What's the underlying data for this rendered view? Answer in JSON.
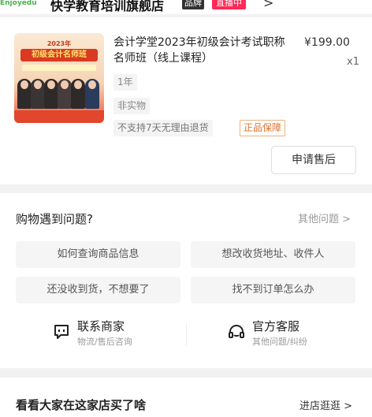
{
  "store": {
    "logo_text": "Enjoyedu",
    "name": "快学教育培训旗舰店",
    "brand_badge": "品牌",
    "live_badge": "直播中",
    "chevron": ">"
  },
  "order": {
    "thumb": {
      "year": "2023年",
      "title": "初级会计名师班"
    },
    "title": "会计学堂2023年初级会计考试职称名师班（线上课程）",
    "price": "¥199.00",
    "qty": "x1",
    "spec_duration": "1年",
    "spec_type": "非实物",
    "tag_no_return": "不支持7天无理由退货",
    "tag_guarantee": "正品保障",
    "aftersale_label": "申请售后"
  },
  "help": {
    "title": "购物遇到问题?",
    "more": "其他问题 >",
    "questions": [
      "如何查询商品信息",
      "想改收货地址、收件人",
      "还没收到货，不想要了",
      "找不到订单怎么办"
    ],
    "contacts": [
      {
        "name": "联系商家",
        "sub": "物流/售后咨询",
        "icon": "chat-bubble-icon"
      },
      {
        "name": "官方客服",
        "sub": "其他问题/纠纷",
        "icon": "headset-icon"
      }
    ]
  },
  "recommend": {
    "title": "看看大家在这家店买了啥",
    "link": "进店逛逛 >"
  },
  "colors": {
    "live": "#ff2a55",
    "guarantee": "#e0712d",
    "background": "#f2f2f2"
  }
}
